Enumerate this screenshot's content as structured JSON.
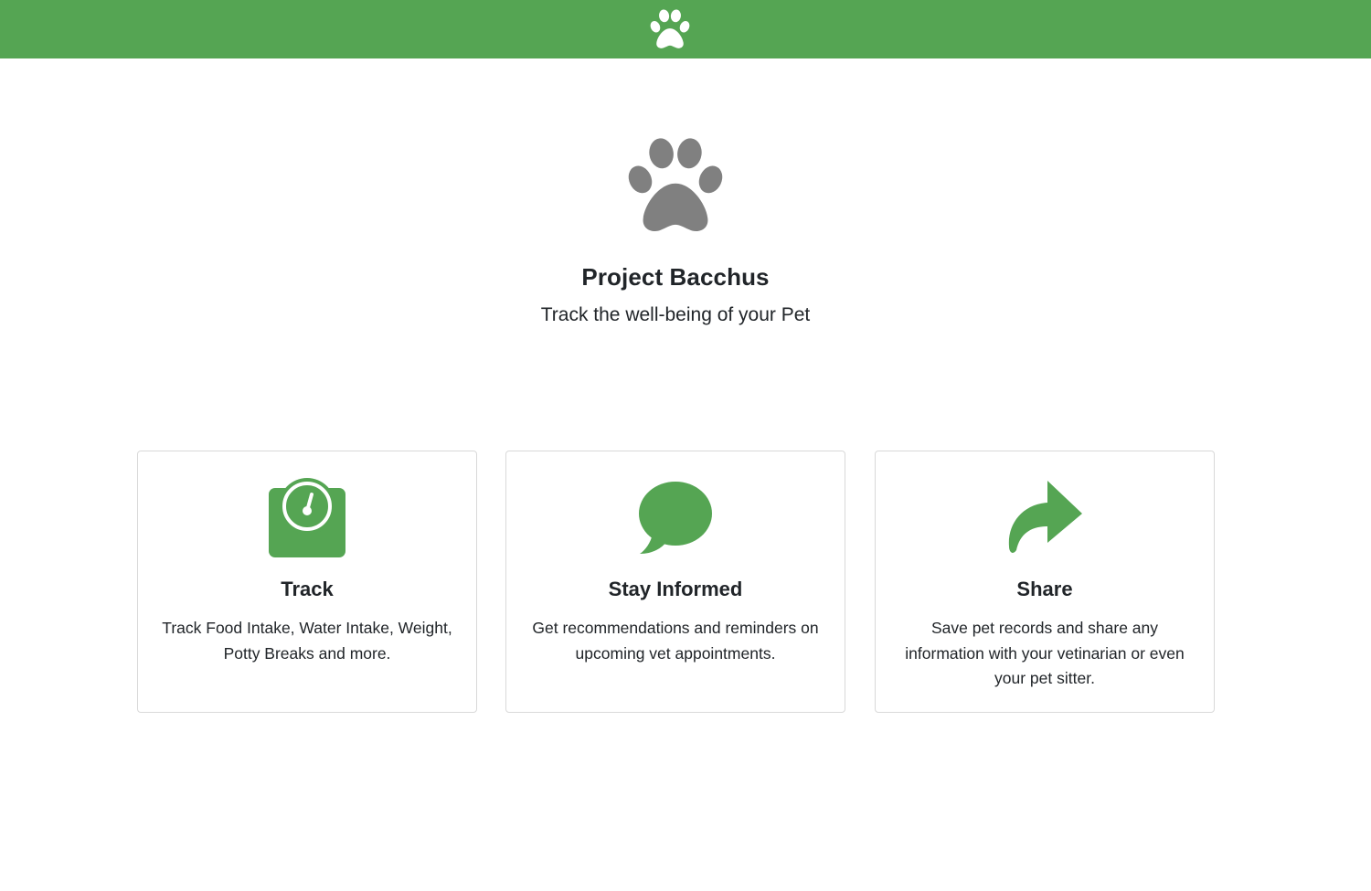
{
  "colors": {
    "brand_green": "#55a553",
    "logo_gray": "#808080",
    "text": "#212529",
    "card_border": "#d9d9d9"
  },
  "navbar": {
    "brand_icon": "paw-icon"
  },
  "hero": {
    "logo_icon": "paw-icon",
    "title": "Project Bacchus",
    "subtitle": "Track the well-being of your Pet"
  },
  "features": [
    {
      "icon": "weight-scale-icon",
      "title": "Track",
      "description": "Track Food Intake, Water Intake, Weight, Potty Breaks and more."
    },
    {
      "icon": "chat-bubble-icon",
      "title": "Stay Informed",
      "description": "Get recommendations and reminders on upcoming vet appointments."
    },
    {
      "icon": "share-arrow-icon",
      "title": "Share",
      "description": "Save pet records and share any information with your vetinarian or even your pet sitter."
    }
  ]
}
